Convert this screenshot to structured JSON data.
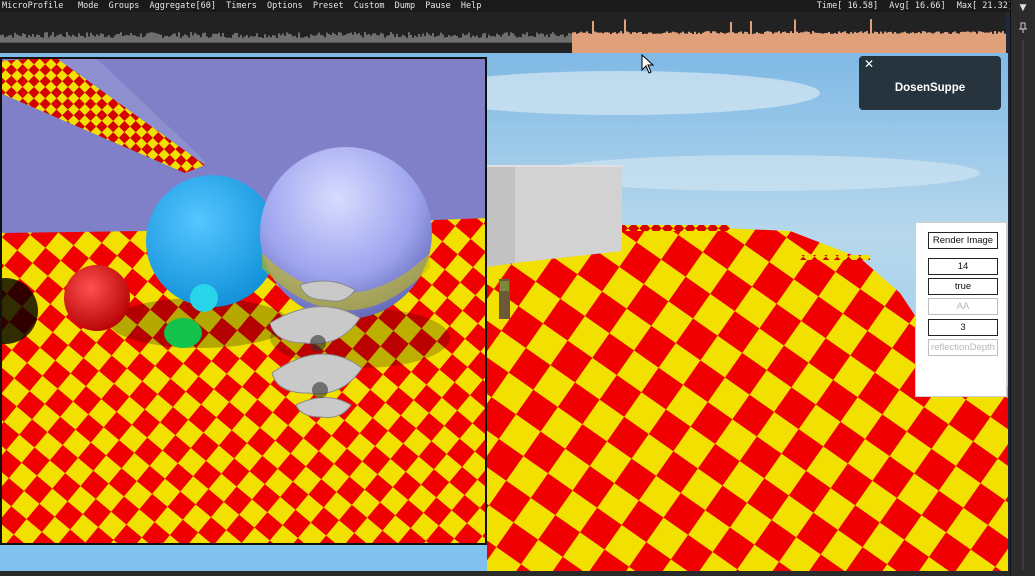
{
  "microprofile": {
    "brand": "MicroProfile",
    "menu": [
      {
        "label": "Mode"
      },
      {
        "label": "Groups"
      },
      {
        "label": "Aggregate[60]"
      },
      {
        "label": "Timers"
      },
      {
        "label": "Options"
      },
      {
        "label": "Preset"
      },
      {
        "label": "Custom"
      },
      {
        "label": "Dump"
      },
      {
        "label": "Pause"
      },
      {
        "label": "Help"
      }
    ],
    "stats": {
      "time": "Time[ 16.58]",
      "avg": "Avg[ 16.66]",
      "max": "Max[ 21.32]"
    },
    "graph_color": "#e0a07a"
  },
  "notification": {
    "name": "DosenSuppe",
    "close_label": "✕"
  },
  "panel": {
    "render_button": "Render Image",
    "field_1_value": "14",
    "field_2_value": "true",
    "aa_placeholder": "AA",
    "field_4_value": "3",
    "reflection_placeholder": "reflectionDepth"
  },
  "icons": {
    "dropdown": "▼",
    "pin": "pin-icon",
    "cursor": "mouse-cursor-icon"
  },
  "colors": {
    "checker_red": "#f00000",
    "checker_yellow": "#f2e000",
    "sky": "#8fc3e6",
    "render_bg": "#7f80c8"
  }
}
